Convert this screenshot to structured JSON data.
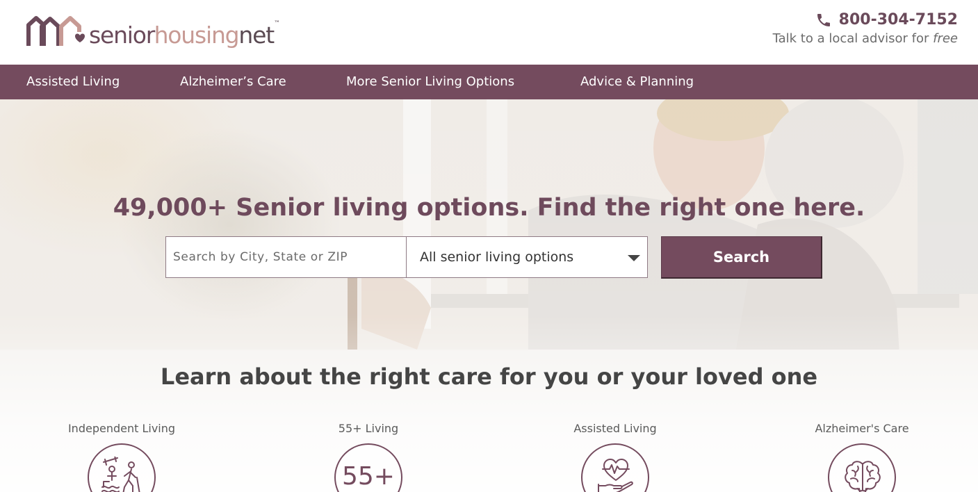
{
  "brand": {
    "logo_part1": "senior",
    "logo_part2": "housing",
    "logo_part3": "net",
    "logo_tm": "™",
    "colors": {
      "primary": "#744b5e",
      "accent": "#c79a94",
      "text": "#555555"
    }
  },
  "header": {
    "phone": "800-304-7152",
    "advisor_text": "Talk to a local advisor for",
    "advisor_free": "free",
    "phone_icon": "phone-icon"
  },
  "nav": {
    "items": [
      {
        "label": "Assisted Living"
      },
      {
        "label": "Alzheimer’s Care"
      },
      {
        "label": "More Senior Living Options"
      },
      {
        "label": "Advice & Planning"
      }
    ]
  },
  "hero": {
    "headline": "49,000+ Senior living options. Find the right one here.",
    "search": {
      "placeholder": "Search by City, State or ZIP",
      "value": "",
      "select_value": "All senior living options",
      "button_label": "Search"
    }
  },
  "learn": {
    "title": "Learn about the right care for you or your loved one",
    "options": [
      {
        "label": "Independent Living",
        "icon": "fitness-activities-icon"
      },
      {
        "label": "55+ Living",
        "icon": "55-plus-icon",
        "icon_text": "55+"
      },
      {
        "label": "Assisted Living",
        "icon": "heart-hand-icon"
      },
      {
        "label": "Alzheimer's Care",
        "icon": "brain-icon"
      }
    ]
  }
}
